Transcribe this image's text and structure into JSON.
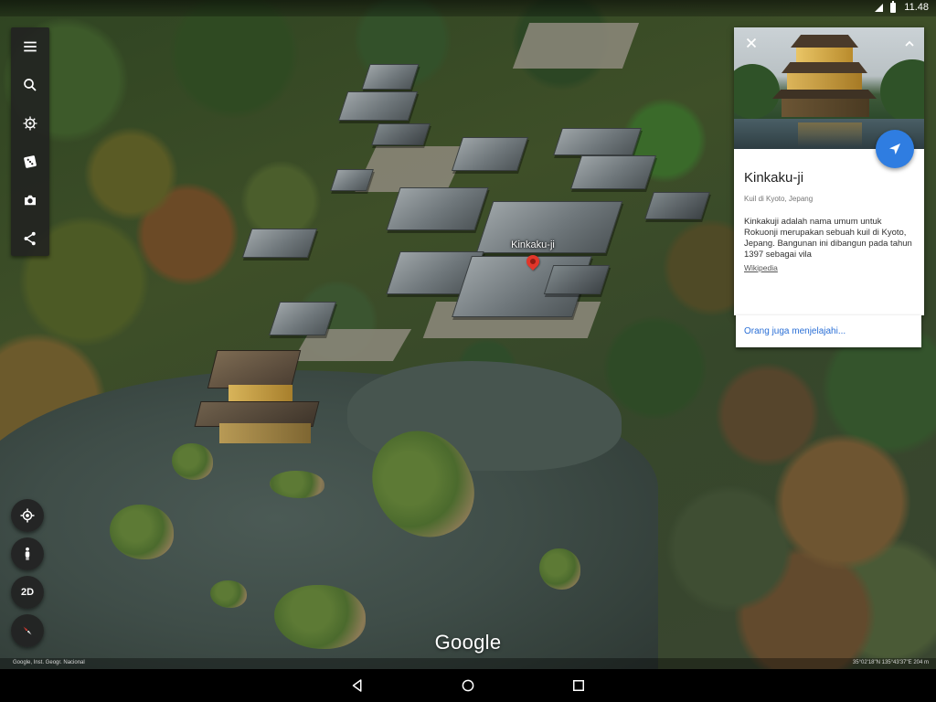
{
  "status_bar": {
    "time": "11.48"
  },
  "toolbar": {
    "items": [
      {
        "icon": "menu-icon"
      },
      {
        "icon": "search-icon"
      },
      {
        "icon": "voyager-icon"
      },
      {
        "icon": "dice-icon"
      },
      {
        "icon": "camera-icon"
      },
      {
        "icon": "share-icon"
      }
    ]
  },
  "map": {
    "pin_label": "Kinkaku-ji",
    "watermark": "Google",
    "attribution": "Google, Inst. Geogr. Nacional",
    "coordinates": "35°02'18\"N 135°43'37\"E 204 m",
    "controls": {
      "mode_label": "2D",
      "icons": [
        "my-location-icon",
        "pegman-icon",
        "compass-icon"
      ]
    }
  },
  "card": {
    "title": "Kinkaku-ji",
    "subtitle": "Kuil di Kyoto, Jepang",
    "description": "Kinkakuji adalah nama umum untuk Rokuonji merupakan sebuah kuil di Kyoto, Jepang. Bangunan ini dibangun pada tahun 1397 sebagai vila",
    "source": "Wikipedia",
    "explore": "Orang juga menjelajahi...",
    "accent_color": "#2f7de1"
  },
  "navbar": {
    "icons": [
      "back-icon",
      "home-icon",
      "recents-icon"
    ]
  }
}
